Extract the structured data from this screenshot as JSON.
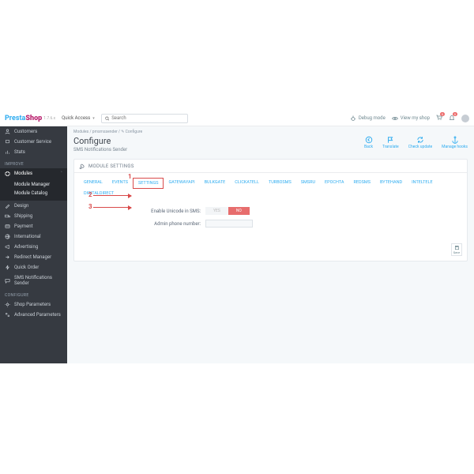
{
  "brand": {
    "part1": "Presta",
    "part2": "Shop",
    "version": "1.7.6.x"
  },
  "header": {
    "quick_access": "Quick Access",
    "search_placeholder": "Search",
    "debug": "Debug mode",
    "view_shop": "View my shop",
    "cart_badge": "0",
    "bell_badge": "0"
  },
  "sidebar": {
    "sell": [
      {
        "icon": "tag",
        "label": "Customers"
      },
      {
        "icon": "headset",
        "label": "Customer Service"
      },
      {
        "icon": "bars",
        "label": "Stats"
      }
    ],
    "improve_head": "IMPROVE",
    "modules": {
      "label": "Modules",
      "sub": [
        "Module Manager",
        "Module Catalog"
      ]
    },
    "improve": [
      {
        "icon": "brush",
        "label": "Design"
      },
      {
        "icon": "truck",
        "label": "Shipping"
      },
      {
        "icon": "card",
        "label": "Payment"
      },
      {
        "icon": "globe",
        "label": "International"
      },
      {
        "icon": "mega",
        "label": "Advertising"
      },
      {
        "icon": "redir",
        "label": "Redirect Manager"
      },
      {
        "icon": "bolt",
        "label": "Quick Order"
      },
      {
        "icon": "sms",
        "label": "SMS Notifications Sender"
      }
    ],
    "configure_head": "CONFIGURE",
    "configure": [
      {
        "icon": "gear",
        "label": "Shop Parameters"
      },
      {
        "icon": "sliders",
        "label": "Advanced Parameters"
      }
    ]
  },
  "breadcrumb": "Modules  /  pmsmssender  /  ✎ Configure",
  "page": {
    "title": "Configure",
    "subtitle": "SMS Notifications Sender"
  },
  "actions": {
    "back": "Back",
    "translate": "Translate",
    "check_update": "Check update",
    "manage_hooks": "Manage hooks"
  },
  "panel": {
    "title": "MODULE SETTINGS",
    "tabs": [
      "GENERAL",
      "EVENTS",
      "SETTINGS",
      "GATEWAYAPI",
      "BULKGATE",
      "CLICKATELL",
      "TURBOSMS",
      "SMSRU",
      "EPOCHTA",
      "REDSMS",
      "BYTEHAND",
      "INTELTELE",
      "DIGITALDIRECT"
    ],
    "active_tab": "SETTINGS",
    "field_unicode": "Enable Unicode in SMS:",
    "toggle_yes": "YES",
    "toggle_no": "NO",
    "field_phone": "Admin phone number:",
    "save": "Save"
  },
  "annotations": {
    "n1": "1",
    "n2": "2",
    "n3": "3"
  }
}
